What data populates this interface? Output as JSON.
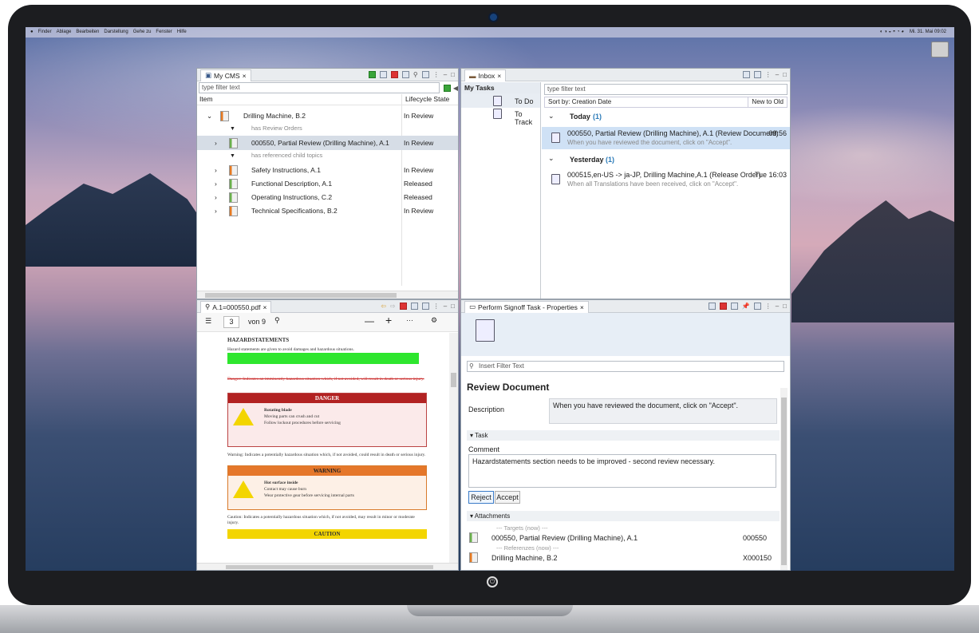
{
  "menubar": {
    "items": [
      "Finder",
      "Ablage",
      "Bearbeiten",
      "Darstellung",
      "Gehe zu",
      "Fenster",
      "Hilfe"
    ],
    "clock": "Mi. 31. Mai 09:02"
  },
  "cms": {
    "tab": "My CMS",
    "filter_placeholder": "type filter text",
    "col_item": "Item",
    "col_state": "Lifecycle State",
    "rows": [
      {
        "label": "Drilling Machine, B.2",
        "state": "In Review"
      },
      {
        "label": "has Review Orders"
      },
      {
        "label": "000550, Partial Review (Drilling Machine), A.1",
        "state": "In Review"
      },
      {
        "label": "has referenced child topics"
      },
      {
        "label": "Safety Instructions, A.1",
        "state": "In Review"
      },
      {
        "label": "Functional Description, A.1",
        "state": "Released"
      },
      {
        "label": "Operating Instructions, C.2",
        "state": "Released"
      },
      {
        "label": "Technical Specifications, B.2",
        "state": "In Review"
      }
    ]
  },
  "inbox": {
    "tab": "Inbox",
    "my_tasks": "My Tasks",
    "todo": "To Do",
    "totrack": "To Track",
    "filter_placeholder": "type filter text",
    "sort": "Sort by: Creation Date",
    "order": "New to Old",
    "today": "Today",
    "today_count": "(1)",
    "yesterday": "Yesterday",
    "yesterday_count": "(1)",
    "items": [
      {
        "title": "000550, Partial Review (Drilling Machine), A.1 (Review Document)",
        "time": "09:56",
        "sub": "When you have reviewed the document, click on \"Accept\"."
      },
      {
        "title": "000515,en-US -> ja-JP, Drilling Machine,A.1 (Release Order)",
        "time": "Tue 16:03",
        "sub": "When all Translations have been received, click on \"Accept\"."
      }
    ]
  },
  "pdf": {
    "tab": "A.1=000550.pdf",
    "page": "3",
    "of": "von 9",
    "heading": "HAZARDSTATEMENTS",
    "danger": "DANGER",
    "warning": "WARNING",
    "caution": "CAUTION",
    "danger_title": "Rotating blade",
    "danger_text": "Moving parts can crush and cut",
    "danger_bullet": "Follow lockout procedures before servicing",
    "warning_title": "Hot surface inside",
    "warning_text": "Contact may cause burn",
    "warning_bullet": "Wear protective gear before servicing internal parts",
    "body1": "Hazard statements are given to avoid damages and hazardous situations.",
    "body2": "Danger: Indicates an imminently hazardous situation which, if not avoided, will result in death or serious injury.",
    "body3": "Warning: Indicates a potentially hazardous situation which, if not avoided, could result in death or serious injury.",
    "body4": "Caution: Indicates a potentially hazardous situation which, if not avoided, may result in minor or moderate injury."
  },
  "props": {
    "tab": "Perform Signoff Task - Properties",
    "filter_placeholder": "Insert Filter Text",
    "title": "Review Document",
    "desc_label": "Description",
    "desc_value": "When you have reviewed the document, click on \"Accept\".",
    "task_section": "Task",
    "comment_label": "Comment",
    "comment_value": "Hazardstatements section needs to be improved - second review necessary.",
    "reject": "Reject",
    "accept": "Accept",
    "attachments": "Attachments",
    "targets": "--- Targets (now) ---",
    "target_item": "000550, Partial Review (Drilling Machine), A.1",
    "target_id": "000550",
    "refs": "--- Referenzes (now) ---",
    "ref_item": "Drilling Machine, B.2",
    "ref_id": "X000150"
  }
}
